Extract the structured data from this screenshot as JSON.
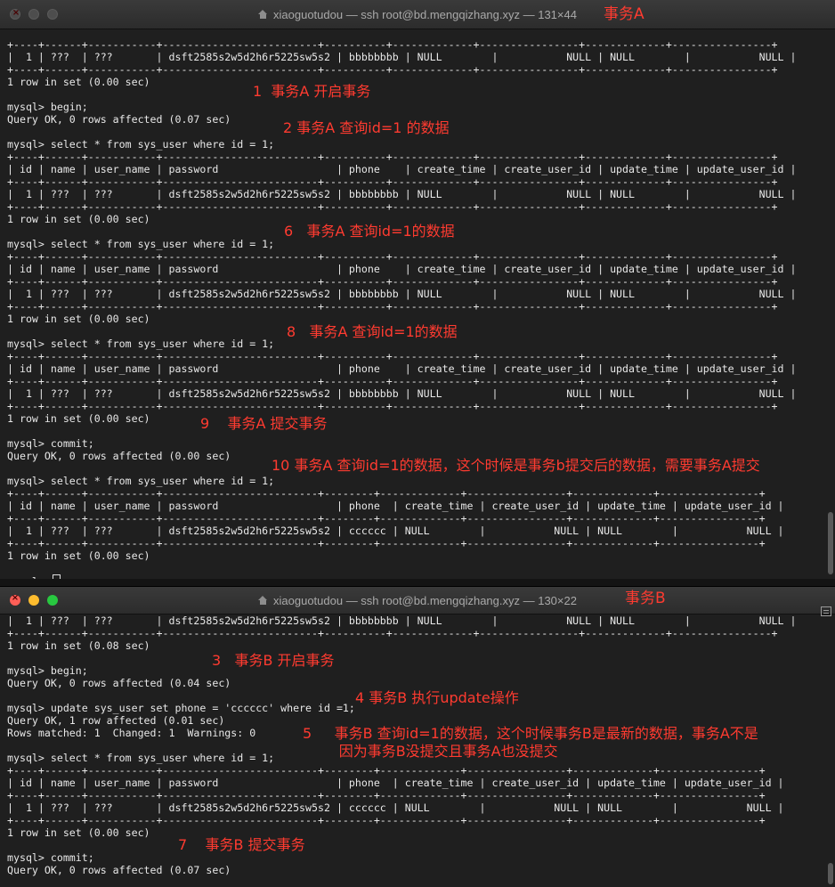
{
  "window_a": {
    "title": "xiaoguotudou — ssh root@bd.mengqizhang.xyz — 131×44",
    "label": "事务A",
    "lines": [
      "+----+------+-----------+-------------------------+----------+-------------+----------------+-------------+----------------+",
      "|  1 | ???  | ???       | dsft2585s2w5d2h6r5225sw5s2 | bbbbbbbb | NULL        |           NULL | NULL        |           NULL |",
      "+----+------+-----------+-------------------------+----------+-------------+----------------+-------------+----------------+",
      "1 row in set (0.00 sec)",
      "",
      "mysql> begin;",
      "Query OK, 0 rows affected (0.07 sec)",
      "",
      "mysql> select * from sys_user where id = 1;",
      "+----+------+-----------+-------------------------+----------+-------------+----------------+-------------+----------------+",
      "| id | name | user_name | password                   | phone    | create_time | create_user_id | update_time | update_user_id |",
      "+----+------+-----------+-------------------------+----------+-------------+----------------+-------------+----------------+",
      "|  1 | ???  | ???       | dsft2585s2w5d2h6r5225sw5s2 | bbbbbbbb | NULL        |           NULL | NULL        |           NULL |",
      "+----+------+-----------+-------------------------+----------+-------------+----------------+-------------+----------------+",
      "1 row in set (0.00 sec)",
      "",
      "mysql> select * from sys_user where id = 1;",
      "+----+------+-----------+-------------------------+----------+-------------+----------------+-------------+----------------+",
      "| id | name | user_name | password                   | phone    | create_time | create_user_id | update_time | update_user_id |",
      "+----+------+-----------+-------------------------+----------+-------------+----------------+-------------+----------------+",
      "|  1 | ???  | ???       | dsft2585s2w5d2h6r5225sw5s2 | bbbbbbbb | NULL        |           NULL | NULL        |           NULL |",
      "+----+------+-----------+-------------------------+----------+-------------+----------------+-------------+----------------+",
      "1 row in set (0.00 sec)",
      "",
      "mysql> select * from sys_user where id = 1;",
      "+----+------+-----------+-------------------------+----------+-------------+----------------+-------------+----------------+",
      "| id | name | user_name | password                   | phone    | create_time | create_user_id | update_time | update_user_id |",
      "+----+------+-----------+-------------------------+----------+-------------+----------------+-------------+----------------+",
      "|  1 | ???  | ???       | dsft2585s2w5d2h6r5225sw5s2 | bbbbbbbb | NULL        |           NULL | NULL        |           NULL |",
      "+----+------+-----------+-------------------------+----------+-------------+----------------+-------------+----------------+",
      "1 row in set (0.00 sec)",
      "",
      "mysql> commit;",
      "Query OK, 0 rows affected (0.00 sec)",
      "",
      "mysql> select * from sys_user where id = 1;",
      "+----+------+-----------+-------------------------+--------+-------------+----------------+-------------+----------------+",
      "| id | name | user_name | password                   | phone  | create_time | create_user_id | update_time | update_user_id |",
      "+----+------+-----------+-------------------------+--------+-------------+----------------+-------------+----------------+",
      "|  1 | ???  | ???       | dsft2585s2w5d2h6r5225sw5s2 | cccccc | NULL        |           NULL | NULL        |           NULL |",
      "+----+------+-----------+-------------------------+--------+-------------+----------------+-------------+----------------+",
      "1 row in set (0.00 sec)",
      "",
      "mysql> "
    ],
    "annotations": [
      "1  事务A 开启事务",
      "2 事务A 查询id=1 的数据",
      "6   事务A 查询id=1的数据",
      "8   事务A 查询id=1的数据",
      "9    事务A 提交事务",
      "10 事务A 查询id=1的数据，这个时候是事务b提交后的数据，需要事务A提交"
    ]
  },
  "window_b": {
    "title": "xiaoguotudou — ssh root@bd.mengqizhang.xyz — 130×22",
    "label": "事务B",
    "lines": [
      "|  1 | ???  | ???       | dsft2585s2w5d2h6r5225sw5s2 | bbbbbbbb | NULL        |           NULL | NULL        |           NULL |",
      "+----+------+-----------+-------------------------+----------+-------------+----------------+-------------+----------------+",
      "1 row in set (0.08 sec)",
      "",
      "mysql> begin;",
      "Query OK, 0 rows affected (0.04 sec)",
      "",
      "mysql> update sys_user set phone = 'cccccc' where id =1;",
      "Query OK, 1 row affected (0.01 sec)",
      "Rows matched: 1  Changed: 1  Warnings: 0",
      "",
      "mysql> select * from sys_user where id = 1;",
      "+----+------+-----------+-------------------------+--------+-------------+----------------+-------------+----------------+",
      "| id | name | user_name | password                   | phone  | create_time | create_user_id | update_time | update_user_id |",
      "+----+------+-----------+-------------------------+--------+-------------+----------------+-------------+----------------+",
      "|  1 | ???  | ???       | dsft2585s2w5d2h6r5225sw5s2 | cccccc | NULL        |           NULL | NULL        |           NULL |",
      "+----+------+-----------+-------------------------+--------+-------------+----------------+-------------+----------------+",
      "1 row in set (0.00 sec)",
      "",
      "mysql> commit;",
      "Query OK, 0 rows affected (0.07 sec)"
    ],
    "annotations": [
      "3   事务B 开启事务",
      "4 事务B 执行update操作",
      "5     事务B 查询id=1的数据，这个时候事务B是最新的数据，事务A不是\n        因为事务B没提交且事务A也没提交",
      "7    事务B 提交事务"
    ]
  },
  "colors": {
    "annotation": "#ff3b30",
    "terminal_text": "#e8e8e8",
    "background": "#1f1f1f"
  }
}
